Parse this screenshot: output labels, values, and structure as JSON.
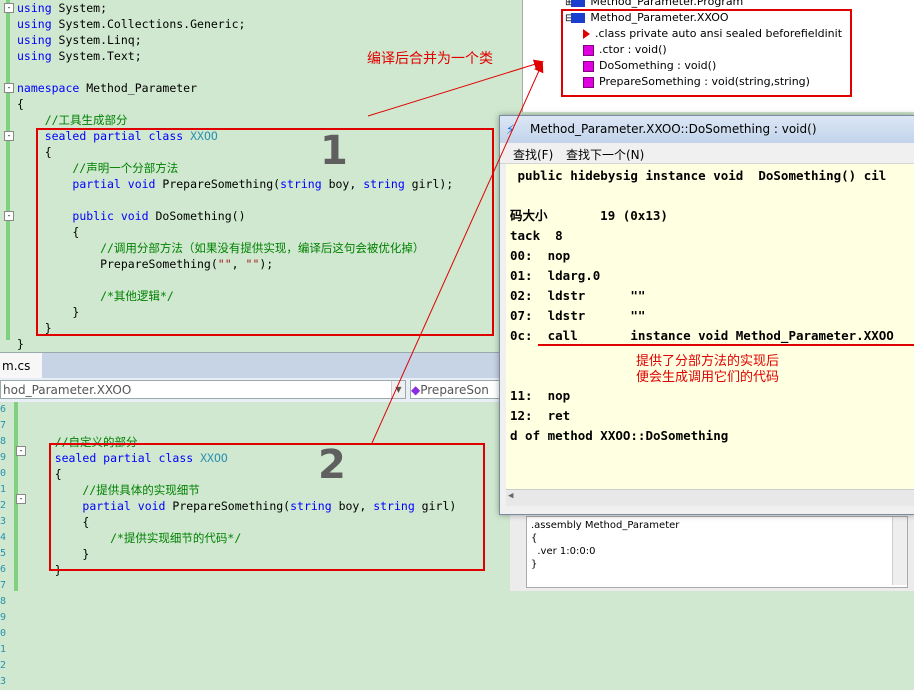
{
  "top_editor": {
    "lines": [
      {
        "parts": [
          {
            "t": "using",
            "c": "kw"
          },
          {
            "t": " System;"
          }
        ]
      },
      {
        "parts": [
          {
            "t": "using",
            "c": "kw"
          },
          {
            "t": " System.Collections.Generic;"
          }
        ]
      },
      {
        "parts": [
          {
            "t": "using",
            "c": "kw"
          },
          {
            "t": " System.Linq;"
          }
        ]
      },
      {
        "parts": [
          {
            "t": "using",
            "c": "kw"
          },
          {
            "t": " System.Text;"
          }
        ]
      },
      {
        "parts": []
      },
      {
        "parts": [
          {
            "t": "namespace",
            "c": "kw"
          },
          {
            "t": " Method_Parameter"
          }
        ]
      },
      {
        "parts": [
          {
            "t": "{"
          }
        ]
      },
      {
        "parts": [
          {
            "t": "    //工具生成部分",
            "c": "cm"
          }
        ]
      },
      {
        "parts": [
          {
            "t": "    "
          },
          {
            "t": "sealed partial class",
            "c": "kw"
          },
          {
            "t": " "
          },
          {
            "t": "XXOO",
            "c": "ty"
          }
        ]
      },
      {
        "parts": [
          {
            "t": "    {"
          }
        ]
      },
      {
        "parts": [
          {
            "t": "        //声明一个分部方法",
            "c": "cm"
          }
        ]
      },
      {
        "parts": [
          {
            "t": "        "
          },
          {
            "t": "partial void",
            "c": "kw"
          },
          {
            "t": " PrepareSomething("
          },
          {
            "t": "string",
            "c": "kw"
          },
          {
            "t": " boy, "
          },
          {
            "t": "string",
            "c": "kw"
          },
          {
            "t": " girl);"
          }
        ]
      },
      {
        "parts": []
      },
      {
        "parts": [
          {
            "t": "        "
          },
          {
            "t": "public void",
            "c": "kw"
          },
          {
            "t": " DoSomething()"
          }
        ]
      },
      {
        "parts": [
          {
            "t": "        {"
          }
        ]
      },
      {
        "parts": [
          {
            "t": "            //调用分部方法（如果没有提供实现，编译后这句会被优化掉）",
            "c": "cm"
          }
        ]
      },
      {
        "parts": [
          {
            "t": "            PrepareSomething("
          },
          {
            "t": "\"\"",
            "c": "st"
          },
          {
            "t": ", "
          },
          {
            "t": "\"\"",
            "c": "st"
          },
          {
            "t": ");"
          }
        ]
      },
      {
        "parts": []
      },
      {
        "parts": [
          {
            "t": "            /*其他逻辑*/",
            "c": "cm"
          }
        ]
      },
      {
        "parts": [
          {
            "t": "        }"
          }
        ]
      },
      {
        "parts": [
          {
            "t": "    }"
          }
        ]
      },
      {
        "parts": [
          {
            "t": "}"
          }
        ]
      }
    ]
  },
  "file_tab": {
    "label": "m.cs"
  },
  "nav_bar": {
    "class_combo": "hod_Parameter.XXOO",
    "method_combo": "PrepareSon"
  },
  "bottom_editor": {
    "line_numbers": [
      "6",
      "7",
      "8",
      "9",
      "0",
      "1",
      "2",
      "3",
      "4",
      "5",
      "6",
      "7",
      "8",
      "9",
      "0",
      "1",
      "2",
      "3"
    ],
    "lines": [
      {
        "parts": []
      },
      {
        "parts": []
      },
      {
        "parts": [
          {
            "t": "    //自定义的部分",
            "c": "cm"
          }
        ]
      },
      {
        "parts": [
          {
            "t": "    "
          },
          {
            "t": "sealed partial class",
            "c": "kw"
          },
          {
            "t": " "
          },
          {
            "t": "XXOO",
            "c": "ty"
          }
        ]
      },
      {
        "parts": [
          {
            "t": "    {"
          }
        ]
      },
      {
        "parts": [
          {
            "t": "        //提供具体的实现细节",
            "c": "cm"
          }
        ]
      },
      {
        "parts": [
          {
            "t": "        "
          },
          {
            "t": "partial void",
            "c": "kw"
          },
          {
            "t": " PrepareSomething("
          },
          {
            "t": "string",
            "c": "kw"
          },
          {
            "t": " boy, "
          },
          {
            "t": "string",
            "c": "kw"
          },
          {
            "t": " girl)"
          }
        ]
      },
      {
        "parts": [
          {
            "t": "        {"
          }
        ]
      },
      {
        "parts": [
          {
            "t": "            /*提供实现细节的代码*/",
            "c": "cm"
          }
        ]
      },
      {
        "parts": [
          {
            "t": "        }"
          }
        ]
      },
      {
        "parts": [
          {
            "t": "    }"
          }
        ]
      }
    ]
  },
  "annotations": {
    "merge_note": "编译后合并为一个类",
    "label_1": "1",
    "label_2": "2",
    "impl_note_line1": "提供了分部方法的实现后",
    "impl_note_line2": "便会生成调用它们的代码"
  },
  "tree_panel": {
    "items": [
      {
        "text": "Method_Parameter.Program",
        "icon": "class-icon",
        "expander": "⊞"
      },
      {
        "text": "Method_Parameter.XXOO",
        "icon": "class-icon",
        "expander": "⊟"
      },
      {
        "text": ".class private auto ansi sealed beforefieldinit",
        "icon": "triangle-icon"
      },
      {
        "text": ".ctor : void()",
        "icon": "method-icon"
      },
      {
        "text": "DoSomething : void()",
        "icon": "method-icon"
      },
      {
        "text": "PrepareSomething : void(string,string)",
        "icon": "method-icon"
      }
    ]
  },
  "il_window": {
    "title": "Method_Parameter.XXOO::DoSomething : void()",
    "menu": [
      "查找(F)",
      "查找下一个(N)"
    ],
    "lines": [
      " public hidebysig instance void  DoSomething() cil",
      "",
      "码大小       19 (0x13)",
      "tack  8",
      "00:  nop",
      "01:  ldarg.0",
      "02:  ldstr      \"\"",
      "07:  ldstr      \"\"",
      "0c:  call       instance void Method_Parameter.XXOO",
      "",
      "",
      "11:  nop",
      "12:  ret",
      "d of method XXOO::DoSomething"
    ]
  },
  "assembly_panel": {
    "lines": [
      ".assembly Method_Parameter",
      "{",
      "  .ver 1:0:0:0",
      "}"
    ]
  },
  "colors": {
    "annotation_red": "#e00000",
    "editor_bg": "#cfe8cf",
    "il_bg": "#ffffe1"
  }
}
